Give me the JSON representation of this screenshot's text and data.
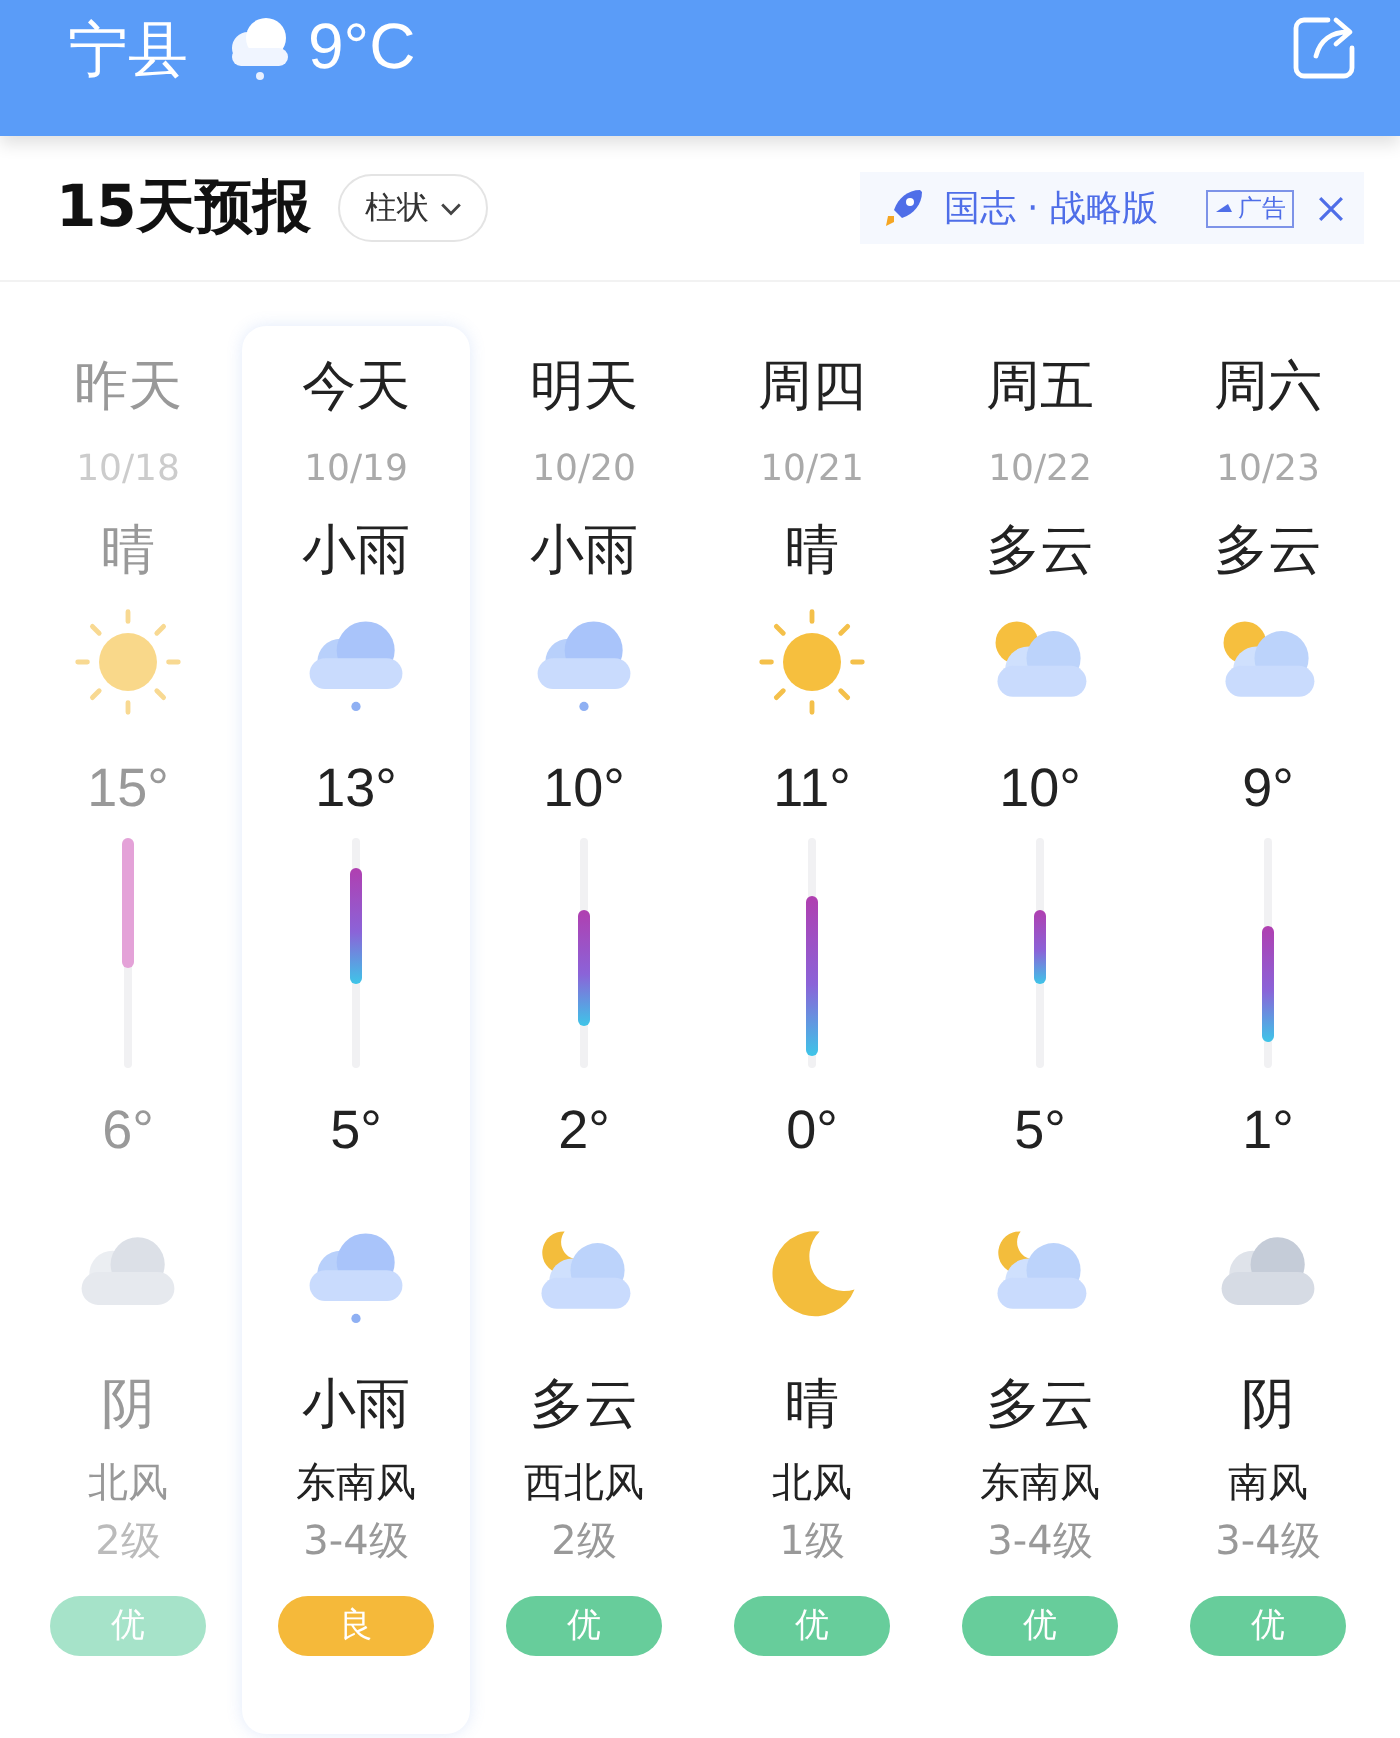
{
  "header": {
    "city": "宁县",
    "weather_icon": {
      "kind": "rain"
    },
    "temperature": "9°C"
  },
  "forecast": {
    "title": "15天预报",
    "view_toggle": "柱状"
  },
  "ad": {
    "text": "国志 · 战略版",
    "tag": "广告"
  },
  "days": [
    {
      "label": "昨天",
      "date": "10/18",
      "day_weather": "晴",
      "day_icon": {
        "kind": "sun"
      },
      "high": "15°",
      "low": "6°",
      "night_icon": {
        "kind": "cloudy"
      },
      "night_weather": "阴",
      "wind": "北风",
      "wind_level": "2级",
      "aqi": {
        "text": "优",
        "color": "#a6e3c9"
      },
      "past": true,
      "selected": false
    },
    {
      "label": "今天",
      "date": "10/19",
      "day_weather": "小雨",
      "day_icon": {
        "kind": "rain"
      },
      "high": "13°",
      "low": "5°",
      "night_icon": {
        "kind": "rain"
      },
      "night_weather": "小雨",
      "wind": "东南风",
      "wind_level": "3-4级",
      "aqi": {
        "text": "良",
        "color": "#f5b93a"
      },
      "past": false,
      "selected": true
    },
    {
      "label": "明天",
      "date": "10/20",
      "day_weather": "小雨",
      "day_icon": {
        "kind": "rain"
      },
      "high": "10°",
      "low": "2°",
      "night_icon": {
        "kind": "partly_cloudy_night"
      },
      "night_weather": "多云",
      "wind": "西北风",
      "wind_level": "2级",
      "aqi": {
        "text": "优",
        "color": "#67cd9b"
      },
      "past": false,
      "selected": false
    },
    {
      "label": "周四",
      "date": "10/21",
      "day_weather": "晴",
      "day_icon": {
        "kind": "sun"
      },
      "high": "11°",
      "low": "0°",
      "night_icon": {
        "kind": "moon"
      },
      "night_weather": "晴",
      "wind": "北风",
      "wind_level": "1级",
      "aqi": {
        "text": "优",
        "color": "#67cd9b"
      },
      "past": false,
      "selected": false
    },
    {
      "label": "周五",
      "date": "10/22",
      "day_weather": "多云",
      "day_icon": {
        "kind": "partly_cloudy"
      },
      "high": "10°",
      "low": "5°",
      "night_icon": {
        "kind": "partly_cloudy_night"
      },
      "night_weather": "多云",
      "wind": "东南风",
      "wind_level": "3-4级",
      "aqi": {
        "text": "优",
        "color": "#67cd9b"
      },
      "past": false,
      "selected": false
    },
    {
      "label": "周六",
      "date": "10/23",
      "day_weather": "多云",
      "day_icon": {
        "kind": "partly_cloudy"
      },
      "high": "9°",
      "low": "1°",
      "night_icon": {
        "kind": "cloudy"
      },
      "night_weather": "阴",
      "wind": "南风",
      "wind_level": "3-4级",
      "aqi": {
        "text": "优",
        "color": "#67cd9b"
      },
      "past": false,
      "selected": false
    }
  ]
}
